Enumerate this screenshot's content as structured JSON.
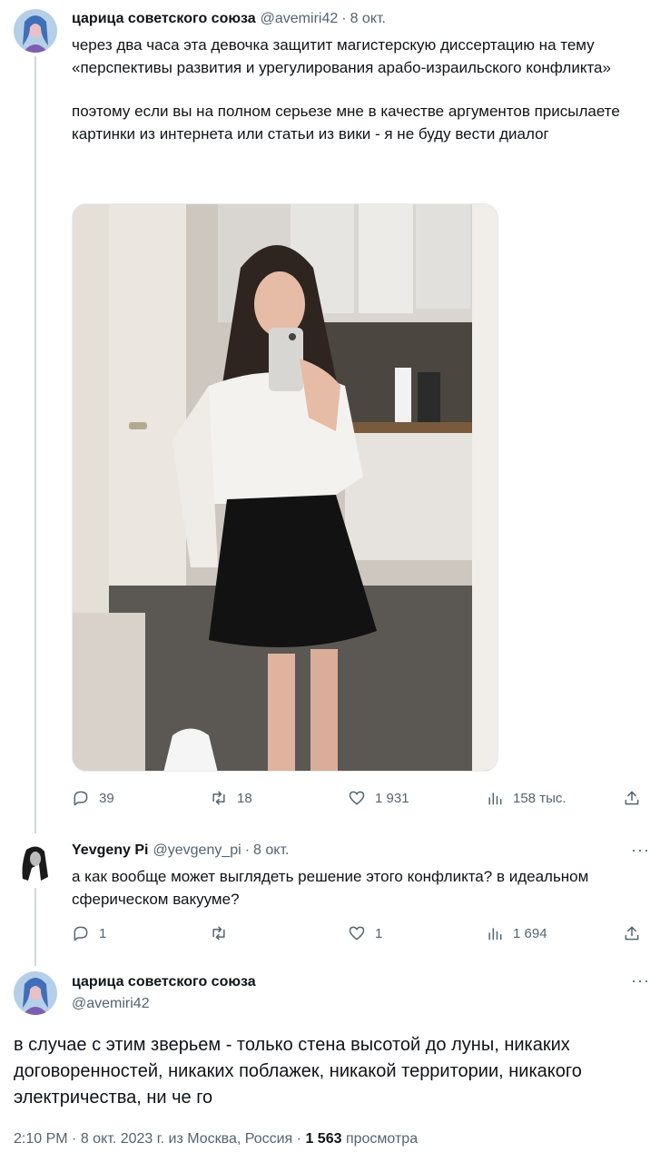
{
  "tweet1": {
    "author_name": "царица советского союза",
    "handle": "@avemiri42",
    "date": "8 окт.",
    "paragraphs": [
      "через два часа эта девочка защитит магистерскую диссертацию на тему «перспективы развития и урегулирования арабо-израильского конфликта»",
      "поэтому если вы на полном серьезе мне в качестве аргументов присылаете картинки из интернета или статьи из вики - я не буду вести диалог"
    ],
    "replies": "39",
    "retweets": "18",
    "likes": "1 931",
    "views": "158 тыс."
  },
  "tweet2": {
    "author_name": "Yevgeny Pi",
    "handle": "@yevgeny_pi",
    "date": "8 окт.",
    "text": "а как вообще может выглядеть решение этого конфликта? в идеальном сферическом вакууме?",
    "replies": "1",
    "retweets": "",
    "likes": "1",
    "views": "1 694",
    "more": "···"
  },
  "tweet3": {
    "author_name": "царица советского союза",
    "handle": "@avemiri42",
    "text": "в случае с этим зверьем - только стена высотой до луны, никаких договоренностей, никаких поблажек, никакой территории, никакого электричества, ни че го",
    "more": "···",
    "time": "2:10 PM",
    "meta_date": "8 окт. 2023 г. из Москва, Россия",
    "separator": "·",
    "views_count": "1 563",
    "views_label": "просмотра"
  },
  "colors": {
    "text": "#0f1419",
    "secondary": "#536471",
    "thread_line": "#cfd9de"
  },
  "icons": [
    "reply-icon",
    "retweet-icon",
    "like-icon",
    "views-icon",
    "share-icon",
    "more-icon"
  ]
}
